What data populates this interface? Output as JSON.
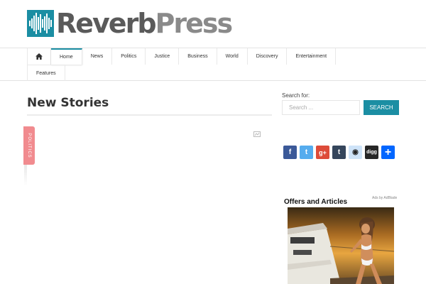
{
  "brand": {
    "name_part1": "Reverb",
    "name_part2": "Press",
    "accent": "#1b8ea3"
  },
  "nav": {
    "row1": [
      {
        "label": "",
        "icon": "home-icon"
      },
      {
        "label": "Home",
        "active": true
      },
      {
        "label": "News"
      },
      {
        "label": "Politics"
      },
      {
        "label": "Justice"
      },
      {
        "label": "Business"
      },
      {
        "label": "World"
      },
      {
        "label": "Discovery"
      },
      {
        "label": "Entertainment"
      }
    ],
    "row2": [
      {
        "label": "Features"
      }
    ]
  },
  "main": {
    "section_title": "New Stories",
    "category_tab": "Politics",
    "category_color": "#f18b8f"
  },
  "sidebar": {
    "search_label": "Search for:",
    "search_placeholder": "Search ...",
    "search_button": "SEARCH",
    "share_buttons": [
      {
        "name": "facebook",
        "icon": "facebook-icon",
        "glyph": "f",
        "color": "#3b5998"
      },
      {
        "name": "twitter",
        "icon": "twitter-icon",
        "glyph": "t",
        "color": "#55acee"
      },
      {
        "name": "google-plus",
        "icon": "google-plus-icon",
        "glyph": "g+",
        "color": "#dd4b39"
      },
      {
        "name": "tumblr",
        "icon": "tumblr-icon",
        "glyph": "t",
        "color": "#35465c"
      },
      {
        "name": "reddit",
        "icon": "reddit-icon",
        "glyph": "◉",
        "color": "#cee3f8"
      },
      {
        "name": "digg",
        "icon": "digg-icon",
        "glyph": "digg",
        "color": "#262626"
      },
      {
        "name": "share",
        "icon": "plus-icon",
        "glyph": "+",
        "color": "#0166ff"
      }
    ],
    "ads_by": "Ads by AdBlade",
    "offers_title": "Offers and Articles"
  }
}
